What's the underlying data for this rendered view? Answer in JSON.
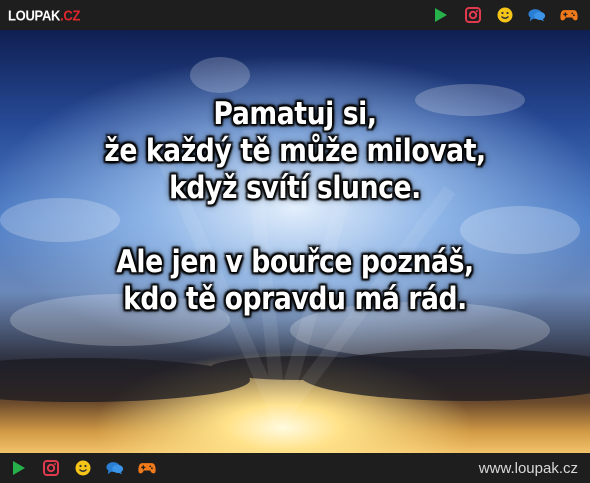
{
  "header": {
    "logo_main": "LOUPAK",
    "logo_tld": ".CZ",
    "icons": [
      "play-icon",
      "instagram-icon",
      "smiley-icon",
      "chat-bubbles-icon",
      "gamepad-icon"
    ]
  },
  "quote": {
    "lines": [
      "Pamatuj si,",
      "že každý tě může milovat,",
      "když svítí slunce.",
      "Ale jen v bouřce poznáš,",
      "kdo tě opravdu má rád."
    ]
  },
  "footer": {
    "icons": [
      "play-icon",
      "instagram-icon",
      "smiley-icon",
      "chat-bubbles-icon",
      "gamepad-icon"
    ],
    "site_url": "www.loupak.cz"
  },
  "colors": {
    "bar_bg": "#1e1e1e",
    "logo_accent": "#e3262b",
    "play": "#27b14a",
    "instagram": "#e03a4e",
    "smiley": "#f5c518",
    "chat": "#2a7fd4",
    "gamepad": "#f07a1a"
  }
}
